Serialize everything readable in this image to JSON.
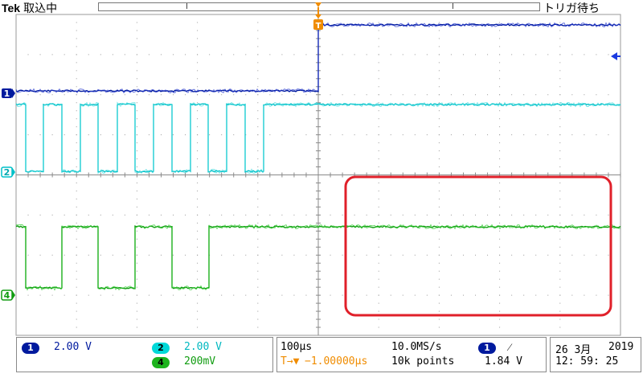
{
  "header": {
    "brand": "Tek",
    "status": "取込中",
    "trigger_status": "トリガ待ち"
  },
  "channels": {
    "ch1": {
      "number": "1",
      "label": "2.00 V",
      "color": "#001a9e"
    },
    "ch2": {
      "number": "2",
      "label": "2.00 V",
      "color": "#00c8c8"
    },
    "ch4": {
      "number": "4",
      "label": "200mV",
      "color": "#1db31d"
    }
  },
  "markers": {
    "ch1": "1",
    "ch2": "2",
    "ch4": "4",
    "trigger": "T"
  },
  "timebase": {
    "scale": "100µs",
    "sample_rate": "10.0MS/s",
    "delay_prefix": "T→▼",
    "delay": "−1.00000µs",
    "record_length": "10k points"
  },
  "trigger": {
    "source": "1",
    "slope": "⁄",
    "level": "1.84 V"
  },
  "datetime": {
    "date": "26 3月",
    "year": "2019",
    "time": "12: 59: 25"
  },
  "annotation": {
    "color": "#e0202a"
  }
}
